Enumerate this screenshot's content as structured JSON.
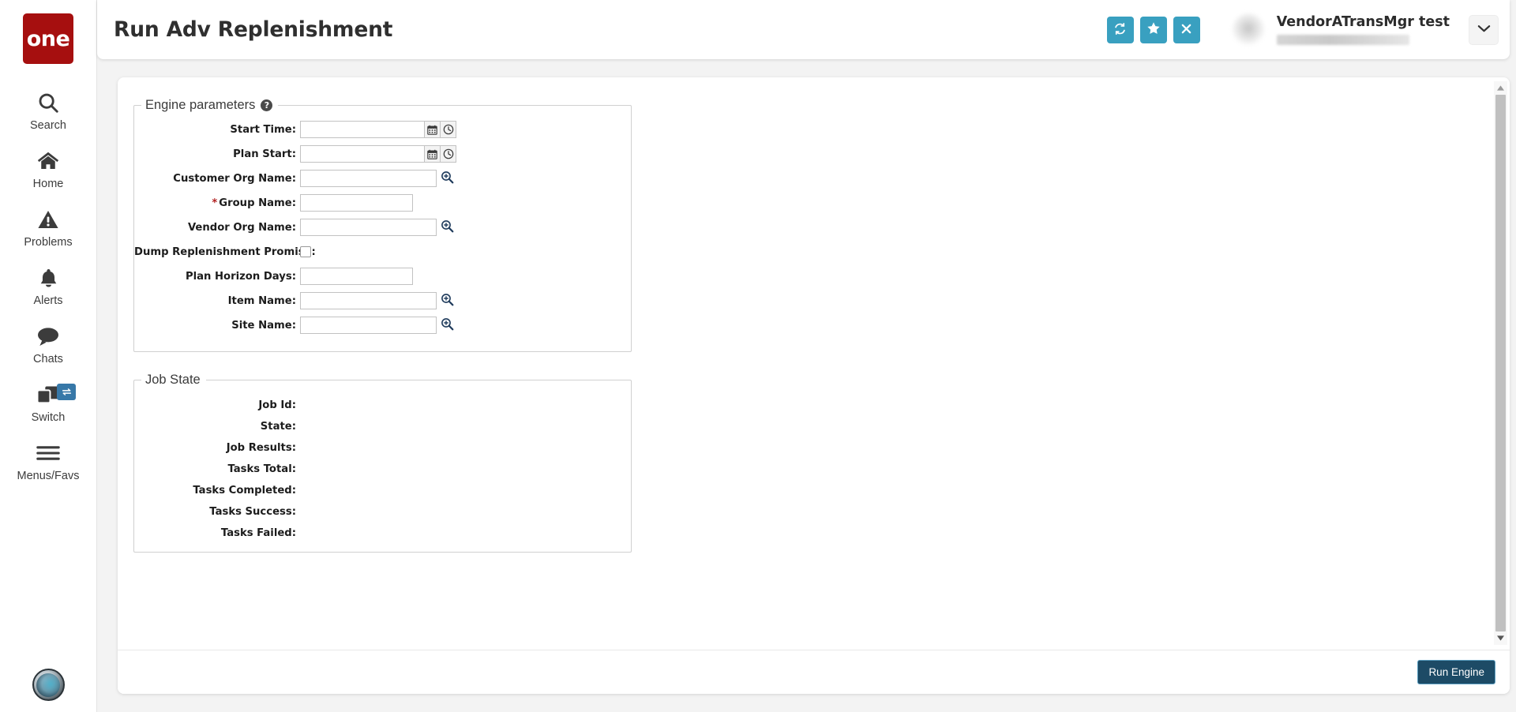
{
  "sidebar": {
    "brand_label": "one",
    "items": [
      {
        "label": "Search",
        "icon": "search-icon"
      },
      {
        "label": "Home",
        "icon": "home-icon"
      },
      {
        "label": "Problems",
        "icon": "warning-triangle-icon"
      },
      {
        "label": "Alerts",
        "icon": "bell-icon"
      },
      {
        "label": "Chats",
        "icon": "chat-bubble-icon"
      },
      {
        "label": "Switch",
        "icon": "windows-stack-icon",
        "badge_icon": "swap-arrows-icon"
      },
      {
        "label": "Menus/Favs",
        "icon": "hamburger-icon"
      }
    ],
    "bottom_avatar": "profile-globe-avatar"
  },
  "header": {
    "title": "Run Adv Replenishment",
    "buttons": [
      {
        "name": "refresh-button",
        "icon": "refresh-arrows-icon",
        "label": ""
      },
      {
        "name": "favorite-button",
        "icon": "star-icon",
        "label": ""
      },
      {
        "name": "close-button",
        "icon": "close-x-icon",
        "label": ""
      }
    ],
    "user": {
      "name": "VendorATransMgr test",
      "subtitle_redacted": true,
      "caret_icon": "chevron-down-icon"
    }
  },
  "engine_parameters": {
    "legend": "Engine parameters",
    "help_icon": "question-mark-icon",
    "fields": [
      {
        "label": "Start Time:",
        "required": false,
        "type": "date",
        "value": "",
        "placeholder": ""
      },
      {
        "label": "Plan Start:",
        "required": false,
        "type": "date",
        "value": "",
        "placeholder": ""
      },
      {
        "label": "Customer Org Name:",
        "required": false,
        "type": "lookup",
        "value": "",
        "placeholder": ""
      },
      {
        "label": "Group Name:",
        "required": true,
        "type": "text",
        "value": "",
        "placeholder": ""
      },
      {
        "label": "Vendor Org Name:",
        "required": false,
        "type": "lookup",
        "value": "",
        "placeholder": ""
      },
      {
        "label": "Dump Replenishment Promise:",
        "required": false,
        "type": "checkbox",
        "checked": false
      },
      {
        "label": "Plan Horizon Days:",
        "required": false,
        "type": "text",
        "value": "",
        "placeholder": ""
      },
      {
        "label": "Item Name:",
        "required": false,
        "type": "lookup",
        "value": "",
        "placeholder": ""
      },
      {
        "label": "Site Name:",
        "required": false,
        "type": "lookup",
        "value": "",
        "placeholder": ""
      }
    ]
  },
  "job_state": {
    "legend": "Job State",
    "rows": [
      {
        "label": "Job Id:",
        "value": ""
      },
      {
        "label": "State:",
        "value": ""
      },
      {
        "label": "Job Results:",
        "value": ""
      },
      {
        "label": "Tasks Total:",
        "value": ""
      },
      {
        "label": "Tasks Completed:",
        "value": ""
      },
      {
        "label": "Tasks Success:",
        "value": ""
      },
      {
        "label": "Tasks Failed:",
        "value": ""
      }
    ]
  },
  "footer": {
    "run_label": "Run Engine"
  },
  "scrollbar": {
    "up_icon": "caret-up-icon",
    "down_icon": "caret-down-icon"
  },
  "colors": {
    "brand_red": "#a60f0f",
    "header_button_teal": "#39a0c0",
    "switch_badge_blue": "#3778a8",
    "run_button": "#1d4b66",
    "required_asterisk": "#b22222"
  }
}
